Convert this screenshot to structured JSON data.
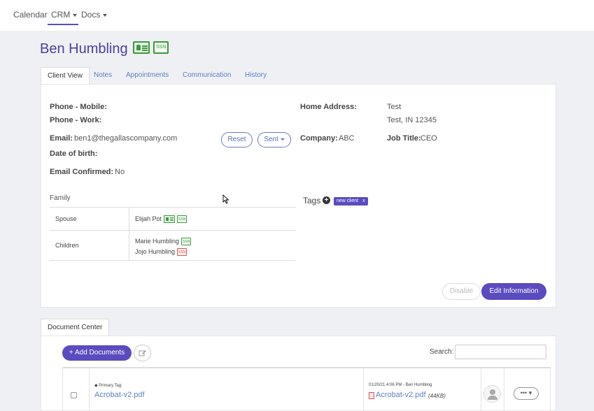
{
  "topnav": {
    "items": [
      {
        "label": "Calendar",
        "has_caret": false
      },
      {
        "label": "CRM",
        "has_caret": true
      },
      {
        "label": "Docs",
        "has_caret": true
      }
    ]
  },
  "client": {
    "name": "Ben Humbling",
    "ssn_badge": "SSN"
  },
  "tabs": [
    "Client View",
    "Notes",
    "Appointments",
    "Communication",
    "History"
  ],
  "client_view": {
    "phone_mobile_label": "Phone - Mobile:",
    "phone_work_label": "Phone - Work:",
    "email_label": "Email:",
    "email_value": "ben1@thegallascompany.com",
    "reset_label": "Reset",
    "sent_label": "Sent",
    "dob_label": "Date of birth:",
    "email_confirmed_label": "Email Confirmed:",
    "email_confirmed_value": "No",
    "home_address_label": "Home Address:",
    "home_address_line1": "Test",
    "home_address_line2": "Test, IN 12345",
    "company_label": "Company:",
    "company_value": "ABC",
    "job_title_label": "Job Title:",
    "job_title_value": "CEO"
  },
  "family": {
    "title": "Family",
    "rows": [
      {
        "relation": "Spouse",
        "members": [
          {
            "name": "Elijah Pot",
            "card": true,
            "ssn": "SSN",
            "ssn_status": "green"
          }
        ]
      },
      {
        "relation": "Children",
        "members": [
          {
            "name": "Marie Humbling",
            "card": false,
            "ssn": "SSN",
            "ssn_status": "green"
          },
          {
            "name": "Jojo Humbling",
            "card": false,
            "ssn": "SSN",
            "ssn_status": "red"
          }
        ]
      }
    ]
  },
  "tags": {
    "label": "Tags",
    "items": [
      {
        "text": "new client",
        "remove": "x"
      }
    ]
  },
  "actions": {
    "disable_label": "Disable",
    "edit_label": "Edit Information"
  },
  "document_center": {
    "tab_label": "Document Center",
    "add_label": "+ Add Documents",
    "search_label": "Search:",
    "search_value": "",
    "rows": [
      {
        "primary_tag": "Primary Tag:",
        "file_name": "Acrobat-v2.pdf",
        "meta": "01/20/21 4:06 PM - Ben Humbling",
        "file_link": "Acrobat-v2.pdf",
        "size": "(44KB)",
        "more_label": "••• ▾"
      }
    ]
  },
  "colors": {
    "brand": "#5a4bbf",
    "link": "#5b7fc7",
    "ssn_green": "#3c9a3c",
    "ssn_red": "#d9534f"
  }
}
